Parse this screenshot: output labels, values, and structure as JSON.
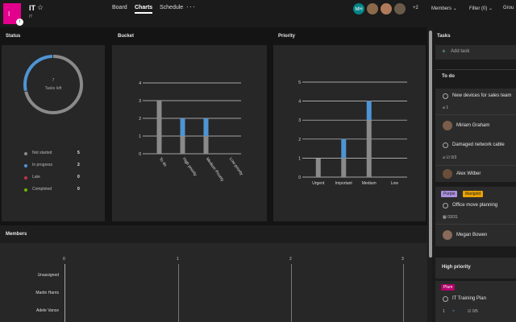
{
  "plan": {
    "initial": "I",
    "name": "IT",
    "subtitle": "IT"
  },
  "nav": {
    "board": "Board",
    "charts": "Charts",
    "schedule": "Schedule",
    "more": "···"
  },
  "header": {
    "avatars": [
      {
        "initials": "MH",
        "color": "#038387"
      },
      {
        "initials": "",
        "color": "#8a6a4a"
      },
      {
        "initials": "",
        "color": "#b07a5a"
      },
      {
        "initials": "",
        "color": "#6a5a4a"
      }
    ],
    "extra_count": "+2",
    "members_label": "Members",
    "filter_label": "Filter (0)",
    "group_label": "Grou"
  },
  "status": {
    "title": "Status",
    "center_number": "7",
    "center_label": "Tasks left",
    "legend": [
      {
        "label": "Not started",
        "count": "5",
        "color": "#8a8a8a"
      },
      {
        "label": "In progress",
        "count": "2",
        "color": "#4f94d4"
      },
      {
        "label": "Late",
        "count": "0",
        "color": "#c4314b"
      },
      {
        "label": "Completed",
        "count": "0",
        "color": "#6bb700"
      }
    ]
  },
  "bucket": {
    "title": "Bucket"
  },
  "priority": {
    "title": "Priority"
  },
  "members": {
    "title": "Members",
    "rows": [
      "Unassigned",
      "Martin Harris",
      "Adele Vance"
    ],
    "axis": [
      "0",
      "1",
      "2",
      "3"
    ]
  },
  "chart_data": [
    {
      "type": "bar",
      "title": "Bucket",
      "categories": [
        "To do",
        "High priority",
        "Medium Priority",
        "Low priority"
      ],
      "series": [
        {
          "name": "Not started",
          "values": [
            3,
            1,
            1,
            0
          ],
          "color": "#8a8a8a"
        },
        {
          "name": "In progress",
          "values": [
            0,
            1,
            1,
            0
          ],
          "color": "#4f94d4"
        }
      ],
      "ylim": [
        0,
        4
      ],
      "yticks": [
        "0",
        "1",
        "2",
        "3",
        "4"
      ],
      "stacked": true
    },
    {
      "type": "bar",
      "title": "Priority",
      "categories": [
        "Urgent",
        "Important",
        "Medium",
        "Low"
      ],
      "series": [
        {
          "name": "Not started",
          "values": [
            1,
            1,
            3,
            0
          ],
          "color": "#8a8a8a"
        },
        {
          "name": "In progress",
          "values": [
            0,
            1,
            1,
            0
          ],
          "color": "#4f94d4"
        }
      ],
      "ylim": [
        0,
        5
      ],
      "yticks": [
        "0",
        "1",
        "2",
        "3",
        "4",
        "5"
      ],
      "stacked": true
    },
    {
      "type": "pie",
      "title": "Status",
      "categories": [
        "Not started",
        "In progress",
        "Late",
        "Completed"
      ],
      "values": [
        5,
        2,
        0,
        0
      ]
    }
  ],
  "tasks": {
    "title": "Tasks",
    "add_task": "Add task",
    "todo_header": "To do",
    "high_header": "High priority",
    "cards": {
      "t1": {
        "title": "New devices for sales team",
        "attach": "1",
        "assignee": "Miriam Graham"
      },
      "t2": {
        "title": "Damaged network cable",
        "checklist": "0/3",
        "assignee": "Alex Wilber"
      },
      "t3": {
        "tag1": "Purple",
        "tag2": "Marigold",
        "title": "Office move planning",
        "checklist": "03/31",
        "assignee": "Megan Bowen"
      },
      "t4": {
        "tag1": "Plum",
        "title": "IT Training Plan",
        "attach": "1",
        "checklist": "0/5"
      }
    }
  }
}
